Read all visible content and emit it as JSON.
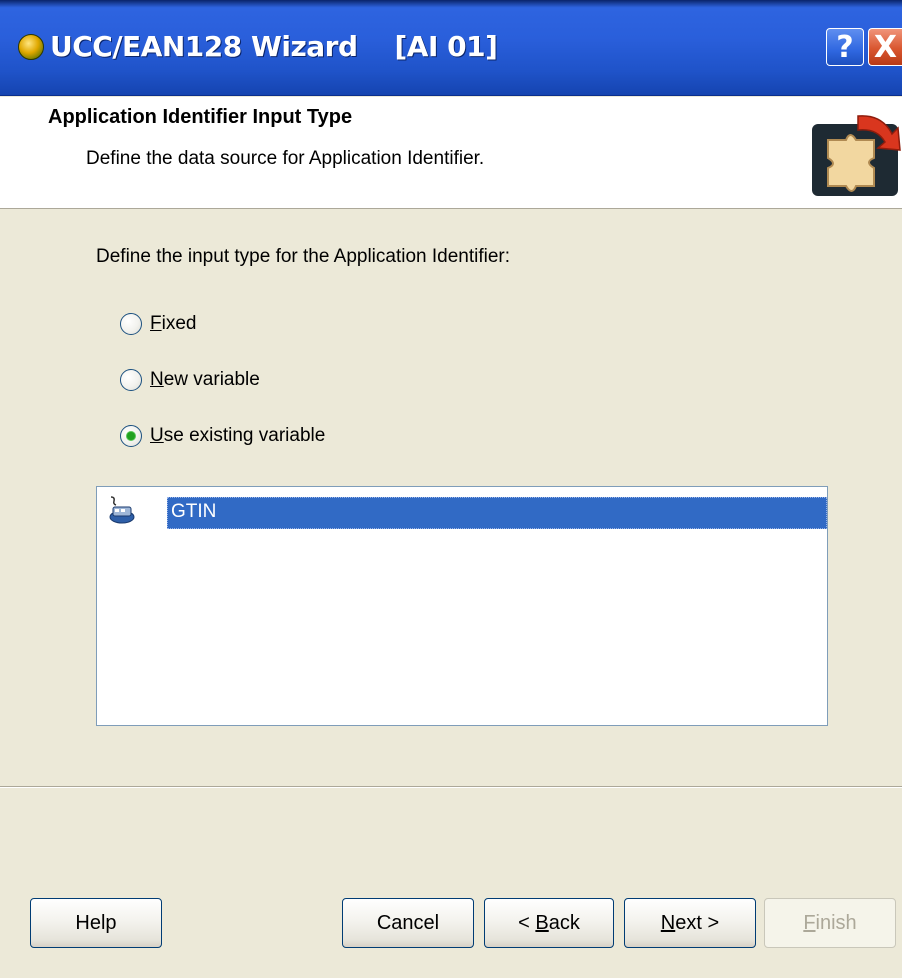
{
  "window": {
    "title": "UCC/EAN128 Wizard    [AI 01]",
    "help_glyph": "?",
    "close_glyph": "X",
    "title_bar_color": "#2A5FDB"
  },
  "header": {
    "title": "Application Identifier Input Type",
    "subtitle": "Define the data source for Application Identifier.",
    "icon": "puzzle-piece-arrow-icon"
  },
  "content": {
    "prompt": "Define the input type for the Application Identifier:",
    "options": [
      {
        "accel": "F",
        "rest": "ixed",
        "selected": false
      },
      {
        "accel": "N",
        "rest": "ew variable",
        "selected": false
      },
      {
        "accel": "U",
        "rest": "se existing variable",
        "selected": true
      }
    ],
    "variables": [
      {
        "name": "GTIN",
        "icon": "variable-icon",
        "selected": true
      }
    ]
  },
  "buttons": {
    "help": "Help",
    "cancel": "Cancel",
    "back_prefix": "< ",
    "back_accel": "B",
    "back_rest": "ack",
    "next_accel": "N",
    "next_rest": "ext",
    "next_suffix": " >",
    "finish_accel": "F",
    "finish_rest": "inish",
    "finish_enabled": false
  },
  "colors": {
    "selection": "#316AC5",
    "dialog_bg": "#ECE9D8",
    "radio_checked": "#21A121"
  }
}
